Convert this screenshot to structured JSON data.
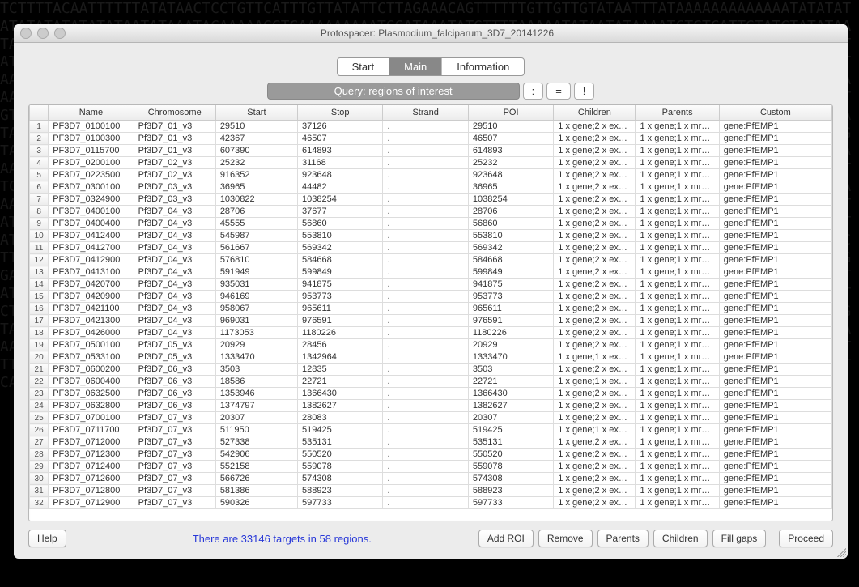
{
  "bg_sequence": "TCTTTTACAATTTTTTATATAACTCCTGTTCATTTGTTATATTCTTAGAAACAGTTTTTTGTTGTTGTATAATTTATAAAAAAAAAAAAATATATATATATATATATATATAATATAAATACAAAAAGGTGAAAAAAAAATGGATAAATATGTTTTAAAAATATAATATAAAATCTCTCATTGTATGTATATAATATTTTGTGCTAAAAAGTAATTGAAGAAATTTCAACCGAAATAATATAGTATTAATATATGAATGGAAAAAAAAAAAAAAAAAAAAATATTATATATATATATATATATATACACGTATATATATATATATATATTATATTAATATATTTTCATTATTATATCGTATATTCTTTTTATAAGTGGAGTCTTTTGTAAATGAGAACGATACATATATATATATTTTATTATTGTATGGTGGATTAAAAAATGTAAAACACCAAACCTATTTACGAAGATTTAGAAAGGATAAAAAATATTAAAAAGAGATGATAAAATAAAAAGAAAATTTCAATGAAACAACATATATATATATATATATATATATATATATATACATATATTATAAGTGTAAAATATATTTTAATAAAATGACATATTTATATAATATATGATCTAGATACAAAAGAGTTCCCCTTTCTAAAAATGGATATGTGTATATCTTTCATATTTTAATTTAAAGAATATATATATATATCTATATATATATACATATATATATATAACCTAAAAATAAAAGAGTGTATCTTAAAAGGTGGTAGGCGTATTTTCATATATAATATTCACCCAAAACTATTGTTGTAATACCCTGTATATGTATAATATATAAAATTCTTTACTAGTGATAAATAAAAAAAATAAAAAATTATGAAGATAGGAACTTACAAAGATTATATATTGTGTTAAAAATTGATATATATATTTATAAAATATAACTATATGTAAAAATTTTTTAATTTCGAGTGTTTAGGAAATGATGACCCTTTTAATAATATTAATATTTTTAAAAAAGGATATAGCTTAAATATCTATGTAATAAGAAAAATTTTCAATGAAAGGTATTTAATAAAGGTATGTCTGTCTACAATGAGTTTAATAATAATAAAAAAAAAAAGGTCGGTCGTATGTAATATAATAAATTTTTCCCCGTGTATATAATATTTTGTGCTAAAAAGTAATTGAAGAAATTTCAACCGAAATAATATAGTATTAATATATGAATGGAAAAAAAAAAAAAAAAAAAAATATTATATATATATATATATATATACACGTATATATATATATATATATTATATTAATATATTTTCATTATTATATCGTATATTCTTTTTATAAGTGGAGTCTTTTGTAAATGAGAACGATACATATATATATATTTTATTATTGTATGGTGGATTAAAAAATGTAAAACACCAAACCTATTTACGAAGATTTAGAAAGGATAAAAAATATTAAAAAGAGATGATAAAATAAAAAGAAAATTTCAATGAAACAACATATATATATATATATATATATATATATATATACATATATTATAAGTGTAAAATATATTTTAATAAAATGACATATTTATATAATATATGATCTAGATACAAAAGAGTTCCCCTTTCTAAAAATGGATATGTGTATATCTTTCATATTTTAATTTAAAGAATATATATATATATCTATATATATATACATATATATATATAACCTAAAAATAAAAGAGTGTATCTTAAAAGGTGGTAGGCGTATTTTCATATATAATATTCACCCAAAACTATTGTTGTAATACCCTGTATATGTATAATATATAAAATTCTTTACTAGTGATAAATAAAAAAAATAAAAAATTATGAAGATAGGAACTTACAAAGATTATATATTGTGTTAAAAATTGATATATATATTTATAAAATATAACTATATGTAAAAATTTTTTAATTTCGAGTGTTTAGGAAATGATGACCCTTTTAATAATATTAATATTTTTAAAAAAGGATATAGCTTAAATATCTATGTAATAAGAAAAATTTTCAATGAAAGGTTGTTTTTTTATCTTTTTTAACCAAATAGAAGAATGTCGGTCGTGATTTCCTTTGTATTTTCTTTTGCCGTGCA",
  "window_title": "Protospacer: Plasmodium_falciparum_3D7_20141226",
  "tabs": {
    "start": "Start",
    "main": "Main",
    "info": "Information"
  },
  "query": {
    "label": "Query: regions of interest",
    "b1": ":",
    "b2": "=",
    "b3": "!"
  },
  "columns": [
    "Name",
    "Chromosome",
    "Start",
    "Stop",
    "Strand",
    "POI",
    "Children",
    "Parents",
    "Custom"
  ],
  "rows": [
    {
      "name": "PF3D7_0100100",
      "chrom": "Pf3D7_01_v3",
      "start": "29510",
      "stop": "37126",
      "strand": ".",
      "poi": "29510",
      "children": "1 x gene;2 x ex…",
      "parents": "1 x gene;1 x mr…",
      "custom": "gene:PfEMP1"
    },
    {
      "name": "PF3D7_0100300",
      "chrom": "Pf3D7_01_v3",
      "start": "42367",
      "stop": "46507",
      "strand": ".",
      "poi": "46507",
      "children": "1 x gene;2 x ex…",
      "parents": "1 x gene;1 x mr…",
      "custom": "gene:PfEMP1"
    },
    {
      "name": "PF3D7_0115700",
      "chrom": "Pf3D7_01_v3",
      "start": "607390",
      "stop": "614893",
      "strand": ".",
      "poi": "614893",
      "children": "1 x gene;2 x ex…",
      "parents": "1 x gene;1 x mr…",
      "custom": "gene:PfEMP1"
    },
    {
      "name": "PF3D7_0200100",
      "chrom": "Pf3D7_02_v3",
      "start": "25232",
      "stop": "31168",
      "strand": ".",
      "poi": "25232",
      "children": "1 x gene;2 x ex…",
      "parents": "1 x gene;1 x mr…",
      "custom": "gene:PfEMP1"
    },
    {
      "name": "PF3D7_0223500",
      "chrom": "Pf3D7_02_v3",
      "start": "916352",
      "stop": "923648",
      "strand": ".",
      "poi": "923648",
      "children": "1 x gene;2 x ex…",
      "parents": "1 x gene;1 x mr…",
      "custom": "gene:PfEMP1"
    },
    {
      "name": "PF3D7_0300100",
      "chrom": "Pf3D7_03_v3",
      "start": "36965",
      "stop": "44482",
      "strand": ".",
      "poi": "36965",
      "children": "1 x gene;2 x ex…",
      "parents": "1 x gene;1 x mr…",
      "custom": "gene:PfEMP1"
    },
    {
      "name": "PF3D7_0324900",
      "chrom": "Pf3D7_03_v3",
      "start": "1030822",
      "stop": "1038254",
      "strand": ".",
      "poi": "1038254",
      "children": "1 x gene;2 x ex…",
      "parents": "1 x gene;1 x mr…",
      "custom": "gene:PfEMP1"
    },
    {
      "name": "PF3D7_0400100",
      "chrom": "Pf3D7_04_v3",
      "start": "28706",
      "stop": "37677",
      "strand": ".",
      "poi": "28706",
      "children": "1 x gene;2 x ex…",
      "parents": "1 x gene;1 x mr…",
      "custom": "gene:PfEMP1"
    },
    {
      "name": "PF3D7_0400400",
      "chrom": "Pf3D7_04_v3",
      "start": "45555",
      "stop": "56860",
      "strand": ".",
      "poi": "56860",
      "children": "1 x gene;2 x ex…",
      "parents": "1 x gene;1 x mr…",
      "custom": "gene:PfEMP1"
    },
    {
      "name": "PF3D7_0412400",
      "chrom": "Pf3D7_04_v3",
      "start": "545987",
      "stop": "553810",
      "strand": ".",
      "poi": "553810",
      "children": "1 x gene;2 x ex…",
      "parents": "1 x gene;1 x mr…",
      "custom": "gene:PfEMP1"
    },
    {
      "name": "PF3D7_0412700",
      "chrom": "Pf3D7_04_v3",
      "start": "561667",
      "stop": "569342",
      "strand": ".",
      "poi": "569342",
      "children": "1 x gene;2 x ex…",
      "parents": "1 x gene;1 x mr…",
      "custom": "gene:PfEMP1"
    },
    {
      "name": "PF3D7_0412900",
      "chrom": "Pf3D7_04_v3",
      "start": "576810",
      "stop": "584668",
      "strand": ".",
      "poi": "584668",
      "children": "1 x gene;2 x ex…",
      "parents": "1 x gene;1 x mr…",
      "custom": "gene:PfEMP1"
    },
    {
      "name": "PF3D7_0413100",
      "chrom": "Pf3D7_04_v3",
      "start": "591949",
      "stop": "599849",
      "strand": ".",
      "poi": "599849",
      "children": "1 x gene;2 x ex…",
      "parents": "1 x gene;1 x mr…",
      "custom": "gene:PfEMP1"
    },
    {
      "name": "PF3D7_0420700",
      "chrom": "Pf3D7_04_v3",
      "start": "935031",
      "stop": "941875",
      "strand": ".",
      "poi": "941875",
      "children": "1 x gene;2 x ex…",
      "parents": "1 x gene;1 x mr…",
      "custom": "gene:PfEMP1"
    },
    {
      "name": "PF3D7_0420900",
      "chrom": "Pf3D7_04_v3",
      "start": "946169",
      "stop": "953773",
      "strand": ".",
      "poi": "953773",
      "children": "1 x gene;2 x ex…",
      "parents": "1 x gene;1 x mr…",
      "custom": "gene:PfEMP1"
    },
    {
      "name": "PF3D7_0421100",
      "chrom": "Pf3D7_04_v3",
      "start": "958067",
      "stop": "965611",
      "strand": ".",
      "poi": "965611",
      "children": "1 x gene;2 x ex…",
      "parents": "1 x gene;1 x mr…",
      "custom": "gene:PfEMP1"
    },
    {
      "name": "PF3D7_0421300",
      "chrom": "Pf3D7_04_v3",
      "start": "969031",
      "stop": "976591",
      "strand": ".",
      "poi": "976591",
      "children": "1 x gene;2 x ex…",
      "parents": "1 x gene;1 x mr…",
      "custom": "gene:PfEMP1"
    },
    {
      "name": "PF3D7_0426000",
      "chrom": "Pf3D7_04_v3",
      "start": "1173053",
      "stop": "1180226",
      "strand": ".",
      "poi": "1180226",
      "children": "1 x gene;2 x ex…",
      "parents": "1 x gene;1 x mr…",
      "custom": "gene:PfEMP1"
    },
    {
      "name": "PF3D7_0500100",
      "chrom": "Pf3D7_05_v3",
      "start": "20929",
      "stop": "28456",
      "strand": ".",
      "poi": "20929",
      "children": "1 x gene;2 x ex…",
      "parents": "1 x gene;1 x mr…",
      "custom": "gene:PfEMP1"
    },
    {
      "name": "PF3D7_0533100",
      "chrom": "Pf3D7_05_v3",
      "start": "1333470",
      "stop": "1342964",
      "strand": ".",
      "poi": "1333470",
      "children": "1 x gene;1 x ex…",
      "parents": "1 x gene;1 x mr…",
      "custom": "gene:PfEMP1"
    },
    {
      "name": "PF3D7_0600200",
      "chrom": "Pf3D7_06_v3",
      "start": "3503",
      "stop": "12835",
      "strand": ".",
      "poi": "3503",
      "children": "1 x gene;2 x ex…",
      "parents": "1 x gene;1 x mr…",
      "custom": "gene:PfEMP1"
    },
    {
      "name": "PF3D7_0600400",
      "chrom": "Pf3D7_06_v3",
      "start": "18586",
      "stop": "22721",
      "strand": ".",
      "poi": "22721",
      "children": "1 x gene;1 x ex…",
      "parents": "1 x gene;1 x mr…",
      "custom": "gene:PfEMP1"
    },
    {
      "name": "PF3D7_0632500",
      "chrom": "Pf3D7_06_v3",
      "start": "1353946",
      "stop": "1366430",
      "strand": ".",
      "poi": "1366430",
      "children": "1 x gene;2 x ex…",
      "parents": "1 x gene;1 x mr…",
      "custom": "gene:PfEMP1"
    },
    {
      "name": "PF3D7_0632800",
      "chrom": "Pf3D7_06_v3",
      "start": "1374797",
      "stop": "1382627",
      "strand": ".",
      "poi": "1382627",
      "children": "1 x gene;2 x ex…",
      "parents": "1 x gene;1 x mr…",
      "custom": "gene:PfEMP1"
    },
    {
      "name": "PF3D7_0700100",
      "chrom": "Pf3D7_07_v3",
      "start": "20307",
      "stop": "28083",
      "strand": ".",
      "poi": "20307",
      "children": "1 x gene;2 x ex…",
      "parents": "1 x gene;1 x mr…",
      "custom": "gene:PfEMP1"
    },
    {
      "name": "PF3D7_0711700",
      "chrom": "Pf3D7_07_v3",
      "start": "511950",
      "stop": "519425",
      "strand": ".",
      "poi": "519425",
      "children": "1 x gene;1 x ex…",
      "parents": "1 x gene;1 x mr…",
      "custom": "gene:PfEMP1"
    },
    {
      "name": "PF3D7_0712000",
      "chrom": "Pf3D7_07_v3",
      "start": "527338",
      "stop": "535131",
      "strand": ".",
      "poi": "535131",
      "children": "1 x gene;2 x ex…",
      "parents": "1 x gene;1 x mr…",
      "custom": "gene:PfEMP1"
    },
    {
      "name": "PF3D7_0712300",
      "chrom": "Pf3D7_07_v3",
      "start": "542906",
      "stop": "550520",
      "strand": ".",
      "poi": "550520",
      "children": "1 x gene;2 x ex…",
      "parents": "1 x gene;1 x mr…",
      "custom": "gene:PfEMP1"
    },
    {
      "name": "PF3D7_0712400",
      "chrom": "Pf3D7_07_v3",
      "start": "552158",
      "stop": "559078",
      "strand": ".",
      "poi": "559078",
      "children": "1 x gene;2 x ex…",
      "parents": "1 x gene;1 x mr…",
      "custom": "gene:PfEMP1"
    },
    {
      "name": "PF3D7_0712600",
      "chrom": "Pf3D7_07_v3",
      "start": "566726",
      "stop": "574308",
      "strand": ".",
      "poi": "574308",
      "children": "1 x gene;2 x ex…",
      "parents": "1 x gene;1 x mr…",
      "custom": "gene:PfEMP1"
    },
    {
      "name": "PF3D7_0712800",
      "chrom": "Pf3D7_07_v3",
      "start": "581386",
      "stop": "588923",
      "strand": ".",
      "poi": "588923",
      "children": "1 x gene;2 x ex…",
      "parents": "1 x gene;1 x mr…",
      "custom": "gene:PfEMP1"
    },
    {
      "name": "PF3D7_0712900",
      "chrom": "Pf3D7_07_v3",
      "start": "590326",
      "stop": "597733",
      "strand": ".",
      "poi": "597733",
      "children": "1 x gene;2 x ex…",
      "parents": "1 x gene;1 x mr…",
      "custom": "gene:PfEMP1"
    }
  ],
  "status": "There are 33146 targets in 58 regions.",
  "buttons": {
    "help": "Help",
    "add_roi": "Add ROI",
    "remove": "Remove",
    "parents": "Parents",
    "children": "Children",
    "fill_gaps": "Fill gaps",
    "proceed": "Proceed"
  }
}
